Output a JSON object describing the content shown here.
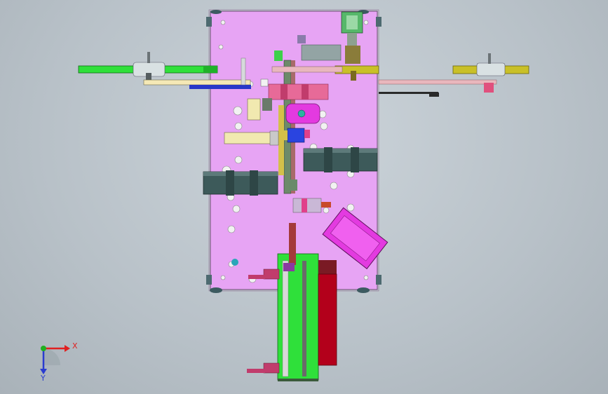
{
  "viewport": {
    "background_top": "#ccd4da",
    "background_bottom": "#a9b2b9"
  },
  "model": {
    "base_plate_color": "#e7a4f4",
    "green_part_color": "#2fe03a",
    "red_part_color": "#b3001b",
    "magenta_part_color": "#e33ae0",
    "slate_part_color": "#3d5a5a",
    "yellow_part_color": "#c9c028"
  },
  "triad": {
    "x_label": "X",
    "y_label": "Y",
    "x_color": "#e02020",
    "y_color": "#2a3cd0",
    "z_color": "#20b020"
  }
}
